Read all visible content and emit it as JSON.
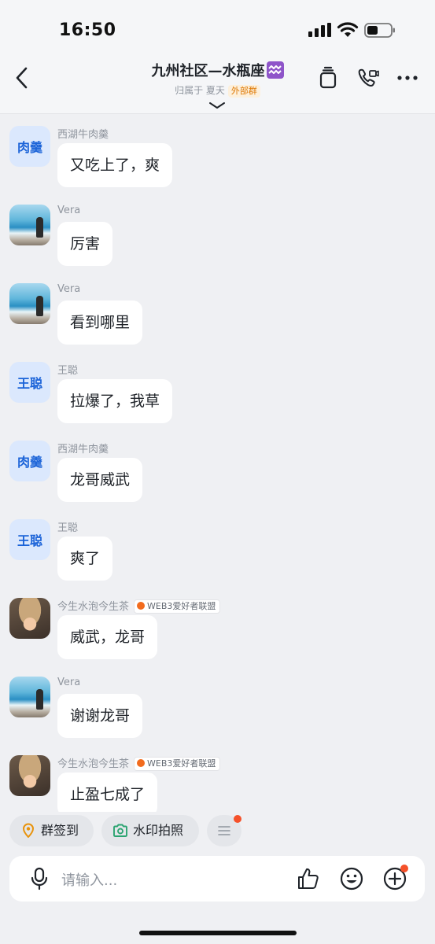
{
  "status_bar": {
    "time": "16:50"
  },
  "header": {
    "title": "九州社区—水瓶座",
    "title_emoji": "♒",
    "subtitle_prefix": "归属于 夏天",
    "external_badge": "外部群"
  },
  "messages": [
    {
      "sender": "西湖牛肉羹",
      "avatar_type": "text",
      "avatar_text": "肉羹",
      "text": "又吃上了，爽"
    },
    {
      "sender": "Vera",
      "avatar_type": "sea",
      "text": "厉害"
    },
    {
      "sender": "Vera",
      "avatar_type": "sea",
      "text": "看到哪里"
    },
    {
      "sender": "王聪",
      "avatar_type": "text",
      "avatar_text": "王聪",
      "text": "拉爆了，我草"
    },
    {
      "sender": "西湖牛肉羹",
      "avatar_type": "text",
      "avatar_text": "肉羹",
      "text": "龙哥威武"
    },
    {
      "sender": "王聪",
      "avatar_type": "text",
      "avatar_text": "王聪",
      "text": "爽了"
    },
    {
      "sender": "今生水泡今生茶",
      "avatar_type": "doll",
      "group_tag": "WEB3爱好者联盟",
      "text": "威武，龙哥"
    },
    {
      "sender": "Vera",
      "avatar_type": "sea",
      "text": "谢谢龙哥"
    },
    {
      "sender": "今生水泡今生茶",
      "avatar_type": "doll",
      "group_tag": "WEB3爱好者联盟",
      "text": "止盈七成了"
    }
  ],
  "quick_actions": [
    {
      "label": "群签到",
      "icon": "location-pin-icon"
    },
    {
      "label": "水印拍照",
      "icon": "camera-icon"
    }
  ],
  "input": {
    "placeholder": "请输入..."
  },
  "icons": {
    "back": "chevron-left-icon",
    "docs": "stacked-docs-icon",
    "call": "phone-video-icon",
    "more": "more-dots-icon",
    "mic": "microphone-icon",
    "like": "thumbs-up-icon",
    "emoji": "smiley-icon",
    "plus": "plus-circle-icon"
  },
  "colors": {
    "accent_blue": "#1b63d8",
    "badge_orange": "#de7802",
    "notification_red": "#f5512a",
    "camera_green": "#2ba471",
    "pin_orange": "#e8930c"
  }
}
